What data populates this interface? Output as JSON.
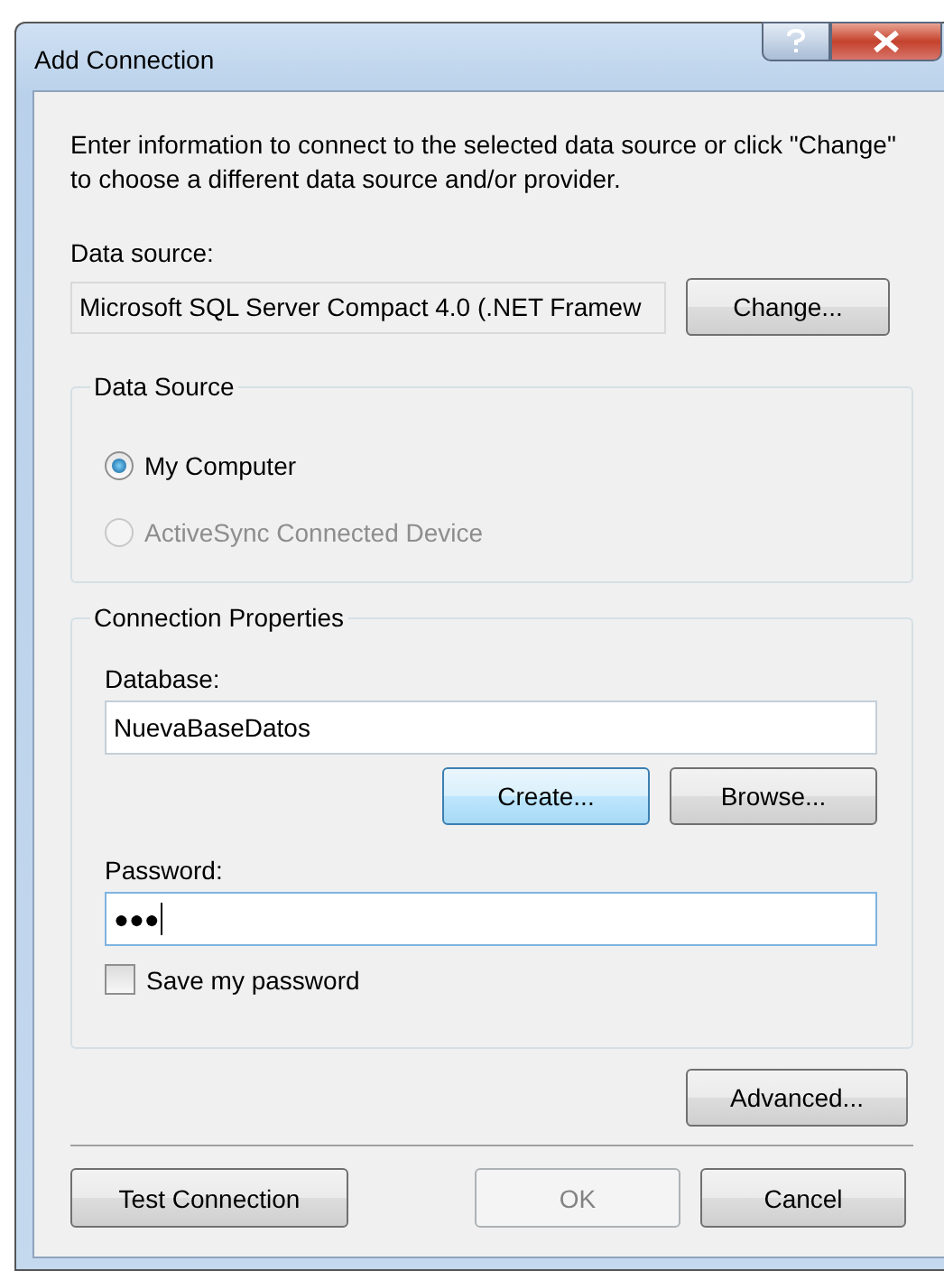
{
  "window": {
    "title": "Add Connection"
  },
  "description": "Enter information to connect to the selected data source or click \"Change\" to choose a different data source and/or provider.",
  "data_source": {
    "label": "Data source:",
    "value": "Microsoft SQL Server Compact 4.0 (.NET Framew",
    "button": "Change..."
  },
  "data_source_group": {
    "title": "Data Source",
    "options": [
      {
        "label": "My Computer",
        "selected": true,
        "disabled": false
      },
      {
        "label": "ActiveSync Connected Device",
        "selected": false,
        "disabled": true
      }
    ]
  },
  "connection_properties": {
    "title": "Connection Properties",
    "database": {
      "label": "Database:",
      "value": "NuevaBaseDatos"
    },
    "buttons": [
      {
        "label": "Create...",
        "highlighted": true
      },
      {
        "label": "Browse...",
        "highlighted": false
      }
    ],
    "password": {
      "label": "Password:",
      "value": "●●●"
    },
    "save_password": {
      "label": "Save my password",
      "checked": false
    }
  },
  "advanced_button": "Advanced...",
  "footer_buttons": [
    {
      "label": "Test Connection",
      "disabled": false
    },
    {
      "label": "OK",
      "disabled": true
    },
    {
      "label": "Cancel",
      "disabled": false
    }
  ]
}
